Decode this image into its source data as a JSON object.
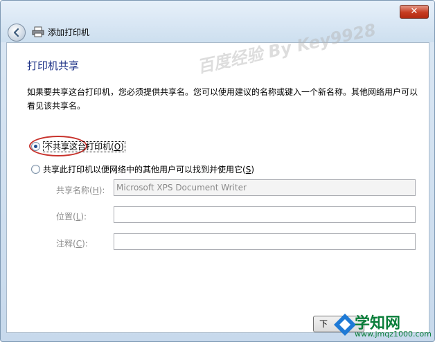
{
  "window": {
    "title": "添加打印机",
    "close_label": "✕"
  },
  "page": {
    "heading": "打印机共享",
    "description": "如果要共享这台打印机，您必须提供共享名。您可以使用建议的名称或键入一个新名称。其他网络用户可以看见该共享名。"
  },
  "options": {
    "no_share_text": "不共享这台打印机",
    "no_share_accel_open": "(",
    "no_share_accel": "O",
    "no_share_accel_close": ")",
    "share_text": "共享此打印机以便网络中的其他用户可以找到并使用它",
    "share_accel_open": "(",
    "share_accel": "S",
    "share_accel_close": ")",
    "selected": "no_share"
  },
  "fields": {
    "share_name_label": "共享名称(",
    "share_name_accel": "H",
    "share_name_tail": "):",
    "share_name_value": "Microsoft XPS Document Writer",
    "location_label": "位置(",
    "location_accel": "L",
    "location_tail": "):",
    "location_value": "",
    "comment_label": "注释(",
    "comment_accel": "C",
    "comment_tail": "):",
    "comment_value": ""
  },
  "buttons": {
    "next_label": "下"
  },
  "watermark": {
    "text": "百度经验 By Key9928",
    "site_name": "学知网",
    "site_url": "www.jmqz1000.com"
  },
  "colors": {
    "heading": "#1e3287",
    "highlight": "#c8322c",
    "logo_green": "#0a7e3a"
  }
}
